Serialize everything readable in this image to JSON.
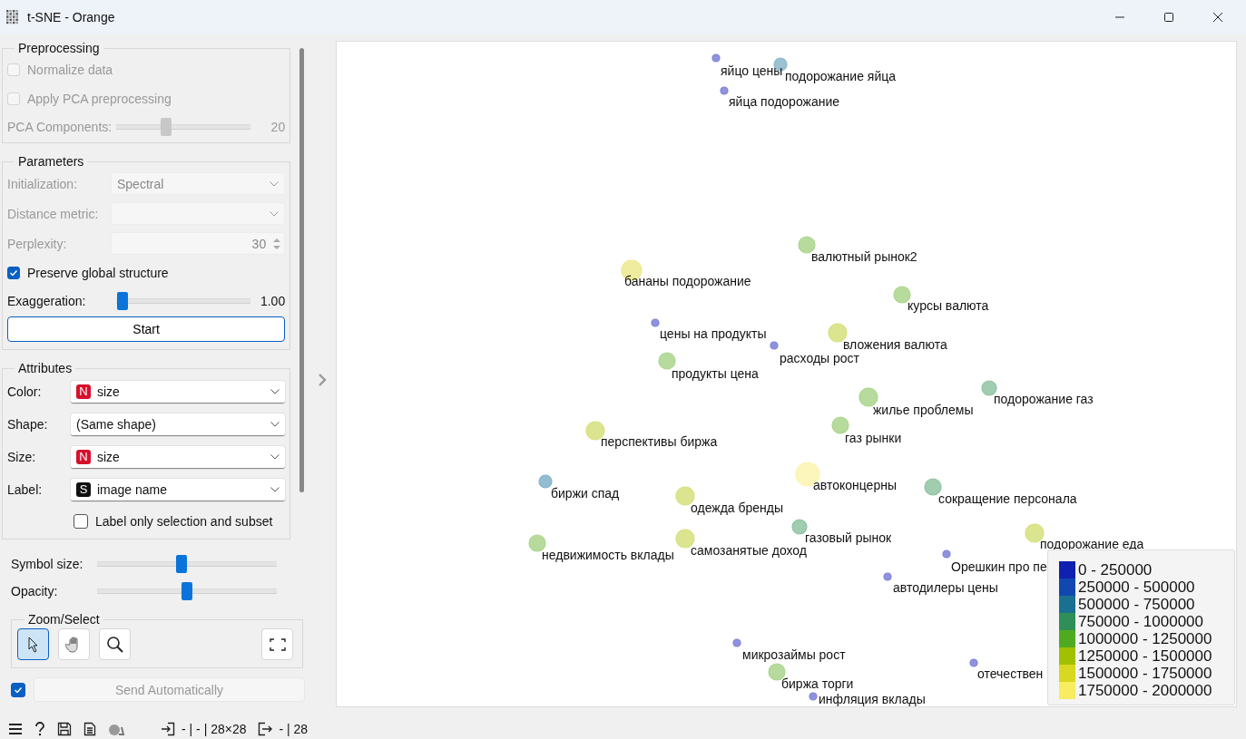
{
  "window": {
    "title": "t-SNE - Orange"
  },
  "preprocessing": {
    "title": "Preprocessing",
    "options": [
      {
        "label": "Normalize data",
        "checked": false,
        "disabled": true
      },
      {
        "label": "Apply PCA preprocessing",
        "checked": false,
        "disabled": true
      }
    ],
    "components": {
      "label": "PCA Components:",
      "level": 0.37,
      "value": "20",
      "disabled": true
    }
  },
  "parameters": {
    "title": "Parameters",
    "initialization": {
      "label": "Initialization:",
      "value": "Spectral",
      "disabled": true
    },
    "distance_metric": {
      "label": "Distance metric:",
      "disabled": true
    },
    "perplexity": {
      "label": "Perplexity:",
      "value": "30",
      "disabled": true
    },
    "preserve": {
      "label": "Preserve global structure",
      "checked": true
    },
    "exaggeration": {
      "label": "Exaggeration:",
      "level": 0.05,
      "value": "1.00"
    },
    "start_button": "Start"
  },
  "attributes": {
    "title": "Attributes",
    "fields": [
      {
        "label": "Color:",
        "badge": "N",
        "kind": "numeric",
        "value": "size"
      },
      {
        "label": "Shape:",
        "value": "(Same shape)"
      },
      {
        "label": "Size:",
        "badge": "N",
        "kind": "numeric",
        "value": "size"
      },
      {
        "label": "Label:",
        "badge": "S",
        "kind": "string",
        "value": "image name"
      }
    ],
    "label_only": {
      "label": "Label only selection and subset",
      "checked": false
    }
  },
  "sliders": [
    {
      "label": "Symbol size:",
      "level": 0.47
    },
    {
      "label": "Opacity:",
      "level": 0.5
    }
  ],
  "zoom_select": {
    "title": "Zoom/Select",
    "tools": [
      {
        "kind": "pointer",
        "selected": true
      },
      {
        "kind": "pan",
        "selected": false
      },
      {
        "kind": "zoom",
        "selected": false
      }
    ]
  },
  "send": {
    "checked": true,
    "label": "Send Automatically",
    "disabled": true
  },
  "plot": {
    "points": [
      {
        "label": "яйцо цены",
        "color": "#7b80d8"
      },
      {
        "label": "подорожание яйца",
        "color": "#8ab6ca"
      },
      {
        "label": "яйца подорожание",
        "color": "#7b80d8"
      },
      {
        "label": "валютный рынок2",
        "color": "#aad58c"
      },
      {
        "label": "бананы подорожание",
        "color": "#ede98e"
      },
      {
        "label": "курсы валюта",
        "color": "#aad58c"
      },
      {
        "label": "цены на продукты",
        "color": "#7b80d8"
      },
      {
        "label": "вложения валюта",
        "color": "#d5e07c"
      },
      {
        "label": "расходы рост",
        "color": "#7b80d8"
      },
      {
        "label": "продукты цена",
        "color": "#aad58c"
      },
      {
        "label": "подорожание газ",
        "color": "#8fc3a1"
      },
      {
        "label": "жилье проблемы",
        "color": "#aad58c"
      },
      {
        "label": "газ рынки",
        "color": "#aad58c"
      },
      {
        "label": "перспективы биржа",
        "color": "#d5e07c"
      },
      {
        "label": "автоконцерны",
        "color": "#fbf4b2"
      },
      {
        "label": "биржи спад",
        "color": "#80b2c9"
      },
      {
        "label": "сокращение персонала",
        "color": "#8fc3a1"
      },
      {
        "label": "одежда бренды",
        "color": "#d5e07c"
      },
      {
        "label": "газовый рынок",
        "color": "#8fc3a1"
      },
      {
        "label": "подорожание еда",
        "color": "#d5e07c"
      },
      {
        "label": "недвижимость вклады",
        "color": "#aad58c"
      },
      {
        "label": "самозанятые доход",
        "color": "#d5e07c"
      },
      {
        "label": "Орешкин про пе",
        "color": "#7b80d8"
      },
      {
        "label": "автодилеры цены",
        "color": "#7b80d8"
      },
      {
        "label": "микрозаймы рост",
        "color": "#7b80d8"
      },
      {
        "label": "отечествен",
        "color": "#7b80d8"
      },
      {
        "label": "биржа торги",
        "color": "#aad58c"
      },
      {
        "label": "инфляция вклады",
        "color": "#7b80d8"
      }
    ],
    "legend": [
      {
        "label": "0 - 250000",
        "color": "#1020b0"
      },
      {
        "label": "250000 - 500000",
        "color": "#1048b0"
      },
      {
        "label": "500000 - 750000",
        "color": "#1a7090"
      },
      {
        "label": "750000 - 1000000",
        "color": "#2e9058"
      },
      {
        "label": "1000000 - 1250000",
        "color": "#50aa20"
      },
      {
        "label": "1250000 - 1500000",
        "color": "#a0c000"
      },
      {
        "label": "1500000 - 1750000",
        "color": "#d8d820"
      },
      {
        "label": "1750000 - 2000000",
        "color": "#f8ec60"
      }
    ]
  },
  "status_bar": {
    "input": "- | - | 28×28",
    "output": "- | 28"
  }
}
